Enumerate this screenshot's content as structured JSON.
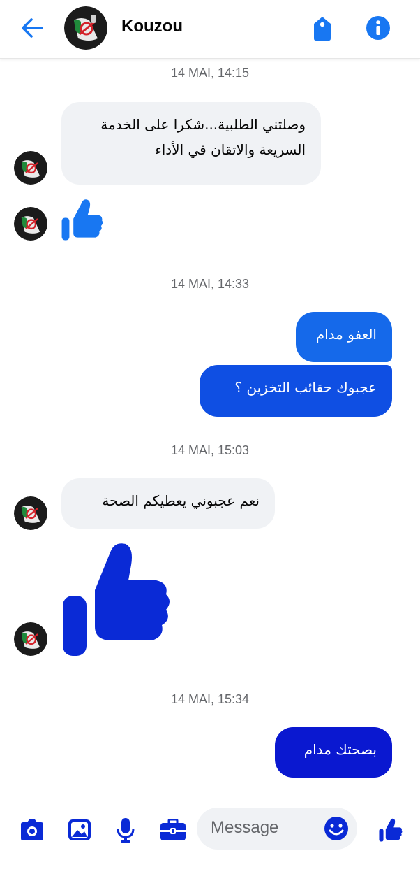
{
  "header": {
    "contact_name": "Kouzou",
    "icons": [
      "back-arrow-icon",
      "avatar",
      "tag-icon",
      "info-icon"
    ]
  },
  "colors": {
    "accent": "#1877f2",
    "deep_blue": "#0a2ad6",
    "incoming_bubble": "#f0f2f5",
    "timestamp": "#65676b"
  },
  "messages": [
    {
      "type": "timestamp",
      "text": "14 MAI, 14:15"
    },
    {
      "type": "incoming",
      "lines": [
        "وصلتني الطلبية...شكرا على الخدمة",
        "السريعة والاتقان في الأداء"
      ]
    },
    {
      "type": "incoming-like",
      "icon": "thumbs-up-icon"
    },
    {
      "type": "timestamp",
      "text": "14 MAI, 14:33"
    },
    {
      "type": "outgoing",
      "text": "العفو مدام"
    },
    {
      "type": "outgoing",
      "text": "عجبوك حقائب التخزين ؟"
    },
    {
      "type": "timestamp",
      "text": "14 MAI, 15:03"
    },
    {
      "type": "incoming",
      "text": "نعم عجبوني يعطيكم الصحة"
    },
    {
      "type": "incoming-like",
      "icon": "thumbs-up-icon",
      "size": "large"
    },
    {
      "type": "timestamp",
      "text": "14 MAI, 15:34"
    },
    {
      "type": "outgoing",
      "text": "بصحتك مدام"
    }
  ],
  "composer": {
    "placeholder": "Message",
    "icons": [
      "camera-icon",
      "image-icon",
      "microphone-icon",
      "briefcase-icon",
      "emoji-icon",
      "thumbs-up-icon"
    ]
  }
}
